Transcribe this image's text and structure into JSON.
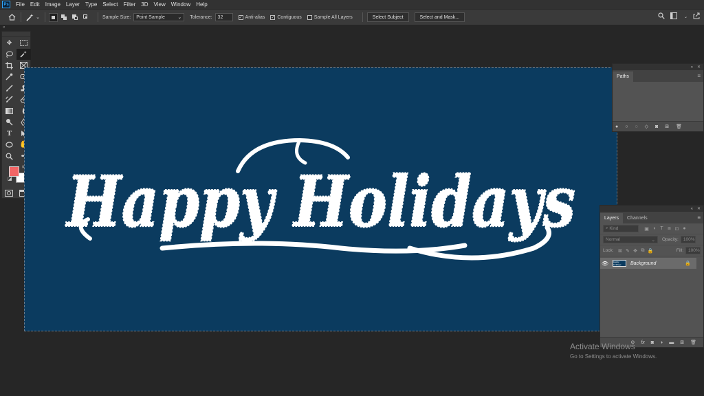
{
  "app": {
    "logo": "Ps"
  },
  "menu": [
    "File",
    "Edit",
    "Image",
    "Layer",
    "Type",
    "Select",
    "Filter",
    "3D",
    "View",
    "Window",
    "Help"
  ],
  "options": {
    "tool_icon": "magic-wand-icon",
    "sample_size_label": "Sample Size:",
    "sample_size_value": "Point Sample",
    "tolerance_label": "Tolerance:",
    "tolerance_value": "32",
    "anti_alias_label": "Anti-alias",
    "anti_alias_checked": true,
    "contiguous_label": "Contiguous",
    "contiguous_checked": true,
    "sample_all_layers_label": "Sample All Layers",
    "sample_all_layers_checked": false,
    "select_subject_label": "Select Subject",
    "select_and_mask_label": "Select and Mask..."
  },
  "colors": {
    "foreground": "#f26565",
    "background": "#ffffff",
    "canvas_bg": "#0b3b5f",
    "text": "#ffffff"
  },
  "canvas": {
    "text": "Happy Holidays"
  },
  "paths_panel": {
    "tab": "Paths"
  },
  "layers_panel": {
    "tabs": [
      "Layers",
      "Channels"
    ],
    "kind_placeholder": "Kind",
    "blend_mode": "Normal",
    "opacity_label": "Opacity:",
    "opacity_value": "100%",
    "lock_label": "Lock:",
    "fill_label": "Fill:",
    "fill_value": "100%",
    "layers": [
      {
        "name": "Background",
        "thumb_text": "Happy Holidays",
        "locked": true,
        "visible": true
      }
    ]
  },
  "watermark": {
    "title": "Activate Windows",
    "subtitle": "Go to Settings to activate Windows."
  }
}
